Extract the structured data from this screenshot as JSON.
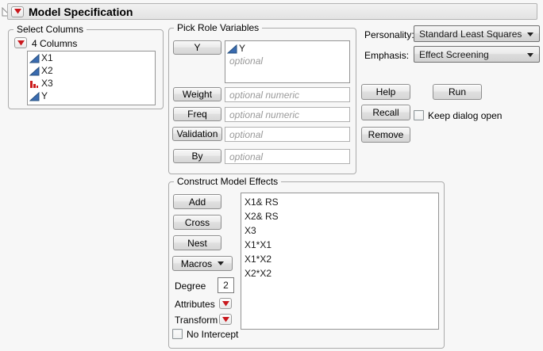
{
  "header": {
    "title": "Model Specification"
  },
  "select_columns": {
    "legend": "Select Columns",
    "count_label": "4 Columns",
    "columns": [
      {
        "name": "X1",
        "icon": "continuous-icon"
      },
      {
        "name": "X2",
        "icon": "continuous-icon"
      },
      {
        "name": "X3",
        "icon": "nominal-icon"
      },
      {
        "name": "Y",
        "icon": "continuous-icon"
      }
    ]
  },
  "pick_roles": {
    "legend": "Pick Role Variables",
    "y_button": "Y",
    "y_item": "Y",
    "y_placeholder": "optional",
    "weight_button": "Weight",
    "weight_placeholder": "optional numeric",
    "freq_button": "Freq",
    "freq_placeholder": "optional numeric",
    "validation_button": "Validation",
    "validation_placeholder": "optional",
    "by_button": "By",
    "by_placeholder": "optional"
  },
  "options": {
    "personality_label": "Personality:",
    "personality_value": "Standard Least Squares",
    "emphasis_label": "Emphasis:",
    "emphasis_value": "Effect Screening",
    "help_button": "Help",
    "run_button": "Run",
    "recall_button": "Recall",
    "remove_button": "Remove",
    "keep_dialog_label": "Keep dialog open",
    "keep_dialog_checked": false
  },
  "model_effects": {
    "legend": "Construct Model Effects",
    "add_button": "Add",
    "cross_button": "Cross",
    "nest_button": "Nest",
    "macros_button": "Macros",
    "degree_label": "Degree",
    "degree_value": "2",
    "attributes_label": "Attributes",
    "transform_label": "Transform",
    "no_intercept_label": "No Intercept",
    "no_intercept_checked": false,
    "effects": [
      "X1& RS",
      "X2& RS",
      "X3",
      "X1*X1",
      "X1*X2",
      "X2*X2"
    ]
  },
  "colors": {
    "accent_red": "#c9181d",
    "continuous_blue": "#3a6bb0",
    "nominal_red": "#cc1a1a"
  }
}
